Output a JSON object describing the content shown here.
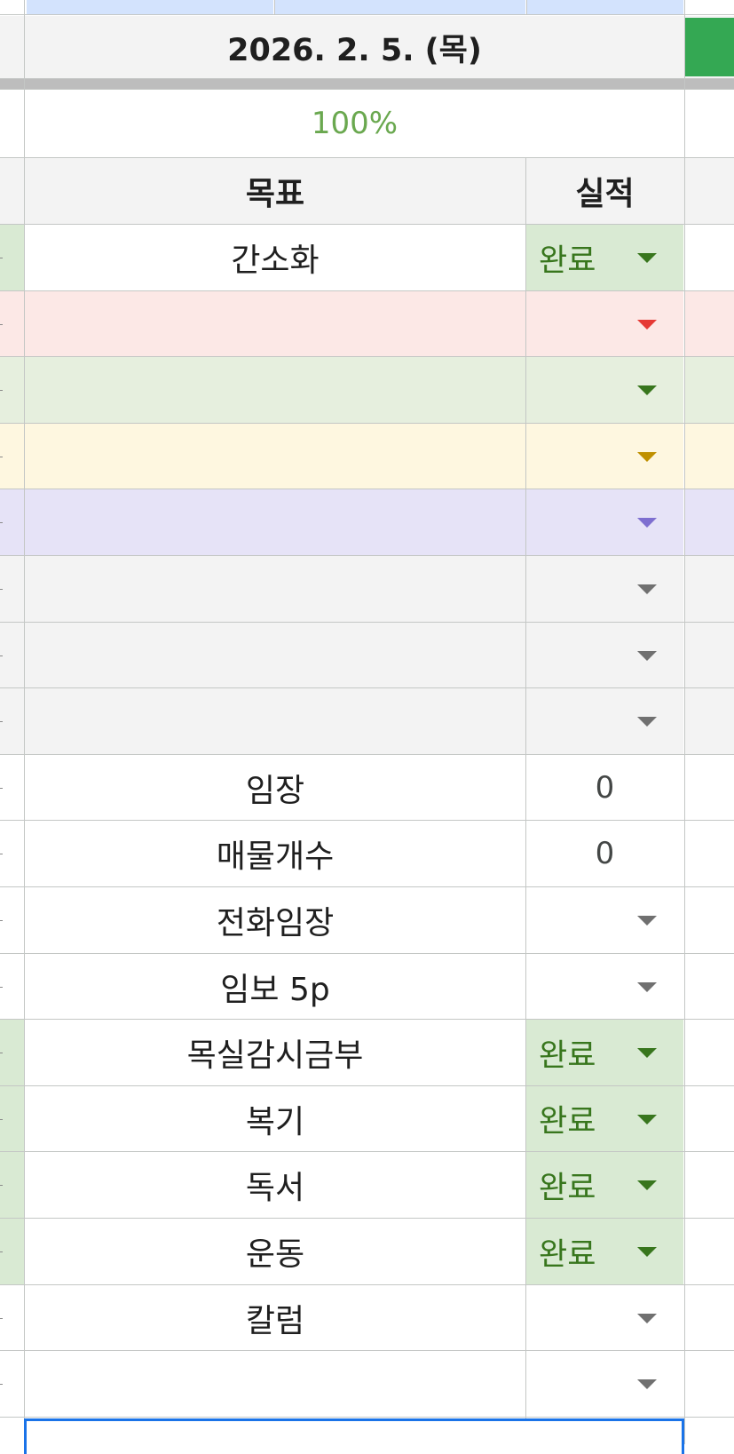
{
  "sheet": {
    "date_header": "2026. 2. 5. (목)",
    "progress": "100%",
    "headers": {
      "goal": "목표",
      "result": "실적"
    },
    "rows": [
      {
        "goal": "간소화",
        "result": "완료",
        "kind": "dropdown",
        "theme": "done"
      },
      {
        "goal": "",
        "result": "",
        "kind": "dropdown",
        "theme": "red"
      },
      {
        "goal": "",
        "result": "",
        "kind": "dropdown",
        "theme": "green"
      },
      {
        "goal": "",
        "result": "",
        "kind": "dropdown",
        "theme": "yellow"
      },
      {
        "goal": "",
        "result": "",
        "kind": "dropdown",
        "theme": "purple"
      },
      {
        "goal": "",
        "result": "",
        "kind": "dropdown",
        "theme": "gray"
      },
      {
        "goal": "",
        "result": "",
        "kind": "dropdown",
        "theme": "gray"
      },
      {
        "goal": "",
        "result": "",
        "kind": "dropdown",
        "theme": "gray"
      },
      {
        "goal": "임장",
        "result": "0",
        "kind": "number",
        "theme": "white"
      },
      {
        "goal": "매물개수",
        "result": "0",
        "kind": "number",
        "theme": "white"
      },
      {
        "goal": "전화임장",
        "result": "",
        "kind": "dropdown",
        "theme": "white"
      },
      {
        "goal": "임보 5p",
        "result": "",
        "kind": "dropdown",
        "theme": "white"
      },
      {
        "goal": "목실감시금부",
        "result": "완료",
        "kind": "dropdown",
        "theme": "done"
      },
      {
        "goal": "복기",
        "result": "완료",
        "kind": "dropdown",
        "theme": "done"
      },
      {
        "goal": "독서",
        "result": "완료",
        "kind": "dropdown",
        "theme": "done"
      },
      {
        "goal": "운동",
        "result": "완료",
        "kind": "dropdown",
        "theme": "done"
      },
      {
        "goal": "칼럼",
        "result": "",
        "kind": "dropdown",
        "theme": "white"
      },
      {
        "goal": "",
        "result": "",
        "kind": "dropdown",
        "theme": "white"
      }
    ]
  },
  "colors": {
    "grid_line": "#c4c7c5",
    "frozen_divider": "#bdbdbd",
    "header_gray": "#f3f3f3",
    "top_strip_blue": "#d3e3fd",
    "accent_green": "#34a853",
    "progress_text": "#6aa84f",
    "done_fill": "#d9ead3",
    "selection_border": "#1a73e8",
    "themes": {
      "done": {
        "left": "#d9ead3",
        "band": "#ffffff",
        "arrow": "#38761d"
      },
      "red": {
        "left": "#fce8e6",
        "band": "#fce8e6",
        "arrow": "#e53935"
      },
      "green": {
        "left": "#e6efde",
        "band": "#e6efde",
        "arrow": "#38761d"
      },
      "yellow": {
        "left": "#fef7e0",
        "band": "#fef7e0",
        "arrow": "#bf9000"
      },
      "purple": {
        "left": "#e6e3f7",
        "band": "#e6e3f7",
        "arrow": "#7e6fd0"
      },
      "gray": {
        "left": "#f3f3f3",
        "band": "#f3f3f3",
        "arrow": "#707070"
      },
      "white": {
        "left": "#ffffff",
        "band": "#ffffff",
        "arrow": "#707070"
      }
    }
  }
}
